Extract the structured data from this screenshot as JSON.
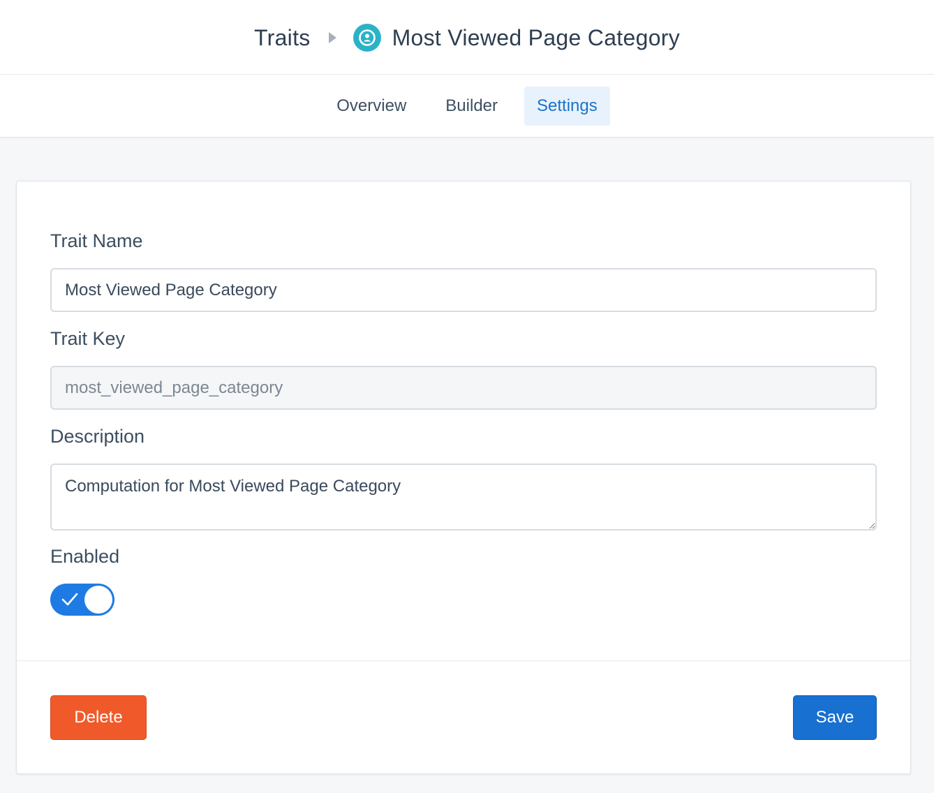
{
  "header": {
    "breadcrumb_root": "Traits",
    "current_title": "Most Viewed Page Category",
    "icon": "person-circle-icon",
    "icon_color": "#2ab2c8"
  },
  "tabs": [
    {
      "label": "Overview",
      "active": false
    },
    {
      "label": "Builder",
      "active": false
    },
    {
      "label": "Settings",
      "active": true
    }
  ],
  "form": {
    "trait_name_label": "Trait Name",
    "trait_name_value": "Most Viewed Page Category",
    "trait_key_label": "Trait Key",
    "trait_key_value": "most_viewed_page_category",
    "description_label": "Description",
    "description_value": "Computation for Most Viewed Page Category",
    "enabled_label": "Enabled",
    "enabled": true
  },
  "actions": {
    "delete_label": "Delete",
    "save_label": "Save"
  },
  "colors": {
    "accent": "#1a73c9",
    "toggle_on": "#1e7be4",
    "delete": "#f05a2b",
    "save": "#1870d0"
  }
}
